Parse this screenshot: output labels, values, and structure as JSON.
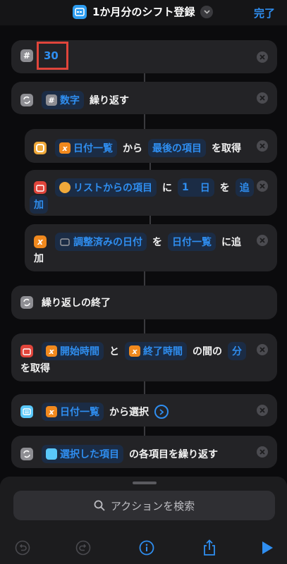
{
  "header": {
    "title": "1か月分のシフト登録",
    "done_label": "完了"
  },
  "actions": {
    "number": {
      "value": "30"
    },
    "repeat": {
      "var": "数字",
      "text": "繰り返す"
    },
    "get_item": {
      "var": "日付一覧",
      "t1": "から",
      "item": "最後の項目",
      "t2": "を取得"
    },
    "add_date": {
      "var": "リストからの項目",
      "t1": "に",
      "num": "1",
      "unit": "日",
      "t2": "を",
      "t3": "追",
      "t4": "加"
    },
    "append": {
      "var": "調整済みの日付",
      "t1": "を",
      "list": "日付一覧",
      "t2": "に追",
      "t3": "加"
    },
    "end_repeat": {
      "text": "繰り返しの終了"
    },
    "time_between": {
      "var1": "開始時間",
      "t1": "と",
      "var2": "終了時間",
      "t2": "の間の",
      "unit": "分",
      "t3": "を取得"
    },
    "choose": {
      "var": "日付一覧",
      "text": "から選択"
    },
    "repeat_each": {
      "var": "選択した項目",
      "text": "の各項目を繰り返す"
    }
  },
  "search": {
    "placeholder": "アクションを検索"
  },
  "colors": {
    "accent": "#2f8ef0",
    "card": "#232326",
    "background": "#0b0b0d",
    "highlight_box": "#e0453b"
  },
  "icons": [
    "undo-icon",
    "redo-icon",
    "info-icon",
    "share-icon",
    "play-icon"
  ]
}
